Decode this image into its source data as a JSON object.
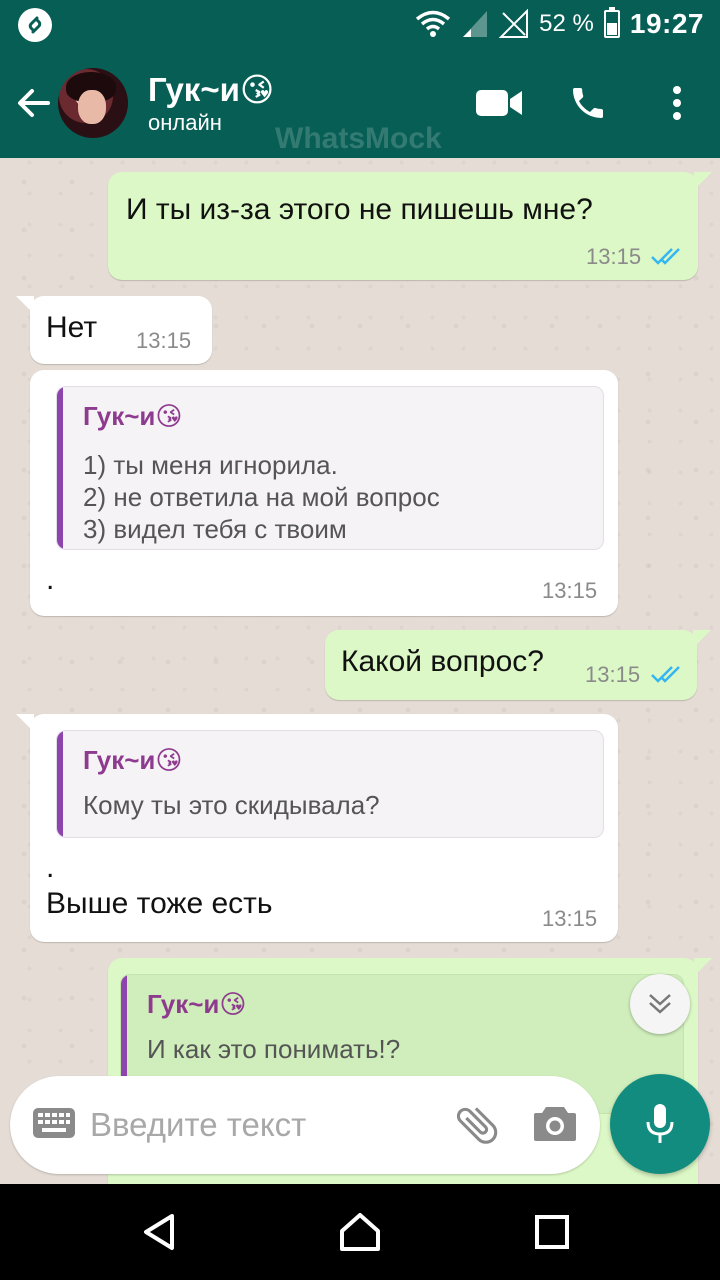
{
  "status_bar": {
    "battery_text": "52 %",
    "battery_level": 0.52,
    "time": "19:27",
    "icons": [
      "shazam-icon",
      "wifi-icon",
      "signal-icon",
      "no-sim-signal-icon",
      "battery-icon"
    ]
  },
  "header": {
    "contact_name": "Гук~и😘",
    "contact_status": "онлайн",
    "watermark": "WhatsMock",
    "icons": [
      "back-arrow-icon",
      "avatar",
      "video-call-icon",
      "phone-icon",
      "more-vert-icon"
    ]
  },
  "messages": [
    {
      "direction": "out",
      "text": "И ты из-за этого не пишешь мне?",
      "time": "13:15",
      "status": "read"
    },
    {
      "direction": "in",
      "text": "Нет",
      "time": "13:15"
    },
    {
      "direction": "in",
      "quote": {
        "author": "Гук~и😘",
        "lines": [
          "1) ты меня игнорила.",
          "2) не ответила на мой вопрос",
          "3) видел тебя с твоим"
        ]
      },
      "text": ".",
      "time": "13:15"
    },
    {
      "direction": "out",
      "text": "Какой вопрос?",
      "time": "13:15",
      "status": "read"
    },
    {
      "direction": "in",
      "quote": {
        "author": "Гук~и😘",
        "lines": [
          "Кому ты это скидывала?"
        ]
      },
      "text_lines": [
        ".",
        "Выше тоже есть"
      ],
      "time": "13:15"
    },
    {
      "direction": "out",
      "quote": {
        "author": "Гук~и😘",
        "lines": [
          "И как это понимать!?"
        ]
      }
    }
  ],
  "input": {
    "placeholder": "Введите текст"
  },
  "colors": {
    "header": "#075e54",
    "outgoing_bubble": "#dcf8c6",
    "incoming_bubble": "#ffffff",
    "read_ticks": "#34b7f1",
    "quote_bar": "#8e44ad",
    "mic_button": "#128c7e"
  }
}
